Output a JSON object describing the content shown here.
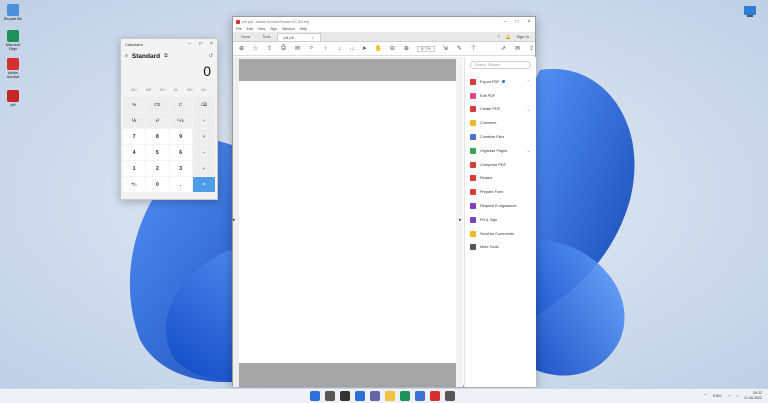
{
  "desktop": {
    "icons": [
      {
        "label": "Recycle Bin",
        "icon": "recycle-bin-icon",
        "color": "#4a8fd8"
      },
      {
        "label": "Microsoft Edge",
        "icon": "edge-icon",
        "color": "#1f8f5a"
      },
      {
        "label": "Adobe Acrobat",
        "icon": "acrobat-icon",
        "color": "#d32f2f"
      },
      {
        "label": "pdf",
        "icon": "pdf-file-icon",
        "color": "#c62828"
      }
    ]
  },
  "calculator": {
    "title": "Calculator",
    "mode": "Standard",
    "display": "0",
    "memory_buttons": [
      "MC",
      "MR",
      "M+",
      "M-",
      "MS",
      "M˅"
    ],
    "keys": [
      {
        "label": "%",
        "kind": "fn"
      },
      {
        "label": "CE",
        "kind": "fn"
      },
      {
        "label": "C",
        "kind": "fn"
      },
      {
        "label": "⌫",
        "kind": "fn"
      },
      {
        "label": "⅟x",
        "kind": "fn"
      },
      {
        "label": "x²",
        "kind": "fn"
      },
      {
        "label": "²√x",
        "kind": "fn"
      },
      {
        "label": "÷",
        "kind": "fn"
      },
      {
        "label": "7",
        "kind": "num"
      },
      {
        "label": "8",
        "kind": "num"
      },
      {
        "label": "9",
        "kind": "num"
      },
      {
        "label": "×",
        "kind": "fn"
      },
      {
        "label": "4",
        "kind": "num"
      },
      {
        "label": "5",
        "kind": "num"
      },
      {
        "label": "6",
        "kind": "num"
      },
      {
        "label": "−",
        "kind": "fn"
      },
      {
        "label": "1",
        "kind": "num"
      },
      {
        "label": "2",
        "kind": "num"
      },
      {
        "label": "3",
        "kind": "num"
      },
      {
        "label": "+",
        "kind": "fn"
      },
      {
        "label": "⁺∕₋",
        "kind": "num"
      },
      {
        "label": "0",
        "kind": "num"
      },
      {
        "label": ".",
        "kind": "num"
      },
      {
        "label": "=",
        "kind": "eq"
      }
    ]
  },
  "acrobat": {
    "title": "pdf.pdf - Adobe Acrobat Reader DC (64-bit)",
    "menu": [
      "File",
      "Edit",
      "View",
      "Sign",
      "Window",
      "Help"
    ],
    "tabs": {
      "home": "Home",
      "tools": "Tools",
      "document": "pdf.pdf"
    },
    "sign_in": "Sign In",
    "page_indicator": "/ 1",
    "zoom": "57.7%",
    "search_placeholder": "Search 'Shapes'",
    "tools": [
      {
        "label": "Export PDF",
        "color": "#d93b3b",
        "chevron": "⌃",
        "badge": true
      },
      {
        "label": "Edit PDF",
        "color": "#e0487a",
        "chevron": "",
        "badge": false
      },
      {
        "label": "Create PDF",
        "color": "#d93b3b",
        "chevron": "⌄",
        "badge": false
      },
      {
        "label": "Comment",
        "color": "#f0b429",
        "chevron": "",
        "badge": false
      },
      {
        "label": "Combine Files",
        "color": "#4a6fd8",
        "chevron": "",
        "badge": false
      },
      {
        "label": "Organize Pages",
        "color": "#3aa356",
        "chevron": "⌄",
        "badge": false
      },
      {
        "label": "Compress PDF",
        "color": "#d93b3b",
        "chevron": "",
        "badge": false
      },
      {
        "label": "Redact",
        "color": "#d93b3b",
        "chevron": "",
        "badge": false
      },
      {
        "label": "Prepare Form",
        "color": "#d93b3b",
        "chevron": "",
        "badge": false
      },
      {
        "label": "Request E-signatures",
        "color": "#7b3fc6",
        "chevron": "",
        "badge": false
      },
      {
        "label": "Fill & Sign",
        "color": "#7b3fc6",
        "chevron": "",
        "badge": false
      },
      {
        "label": "Send for Comments",
        "color": "#f0b429",
        "chevron": "",
        "badge": false
      },
      {
        "label": "More Tools",
        "color": "#555555",
        "chevron": "",
        "badge": false
      }
    ]
  },
  "taskbar": {
    "apps": [
      {
        "name": "start-icon",
        "color": "#2d6ed7"
      },
      {
        "name": "search-icon",
        "color": "#555555"
      },
      {
        "name": "task-view-icon",
        "color": "#333333"
      },
      {
        "name": "widgets-icon",
        "color": "#2d6ed7"
      },
      {
        "name": "chat-icon",
        "color": "#6264a7"
      },
      {
        "name": "file-explorer-icon",
        "color": "#f0c040"
      },
      {
        "name": "edge-icon",
        "color": "#1f8f5a"
      },
      {
        "name": "store-icon",
        "color": "#3a72d8"
      },
      {
        "name": "acrobat-icon",
        "color": "#d32f2f"
      },
      {
        "name": "calculator-icon",
        "color": "#555555"
      }
    ],
    "time": "05:22",
    "date": "21-06-2022",
    "lang": "ENG"
  }
}
